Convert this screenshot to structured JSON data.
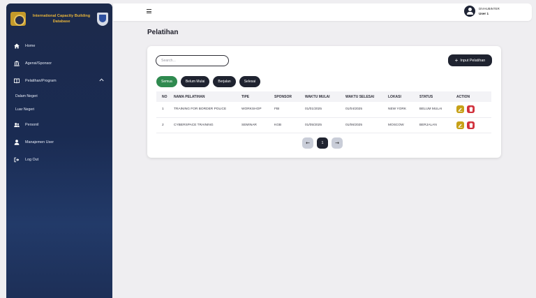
{
  "brand": {
    "title": "International Capacity Building Database"
  },
  "sidebar": {
    "items": [
      {
        "label": "Home",
        "icon": "home-icon"
      },
      {
        "label": "Agensi/Sponsor",
        "icon": "bank-icon"
      },
      {
        "label": "Pelatihan/Program",
        "icon": "book-icon",
        "expanded": true
      },
      {
        "label": "Dalam Negeri"
      },
      {
        "label": "Luar Negeri"
      },
      {
        "label": "Personil",
        "icon": "users-icon"
      },
      {
        "label": "Manajemen User",
        "icon": "user-icon"
      },
      {
        "label": "Log Out",
        "icon": "logout-icon"
      }
    ]
  },
  "topbar": {
    "user_name": "DIVHUBINTER",
    "user_role": "User 1"
  },
  "page": {
    "title": "Pelatihan"
  },
  "toolbar": {
    "search_placeholder": "Search...",
    "add_label": "Input Pelatihan"
  },
  "filters": [
    "Semua",
    "Belum Mulai",
    "Berjalan",
    "Selesai"
  ],
  "table": {
    "headers": [
      "NO",
      "NAMA PELATIHAN",
      "TIPE",
      "SPONSOR",
      "WAKTU MULAI",
      "WAKTU SELESAI",
      "LOKASI",
      "STATUS",
      "ACTION"
    ],
    "rows": [
      [
        "1",
        "TRAINING FOR BORDER POLICE",
        "WORKSHOP",
        "FBI",
        "01/01/2025",
        "01/04/2025",
        "NEW YORK",
        "BELUM MULAI"
      ],
      [
        "2",
        "CYBERSPACE TRAINING",
        "SEMINAR",
        "KGB",
        "01/05/2025",
        "01/06/2025",
        "MOSCOW",
        "BERJALAN"
      ]
    ]
  },
  "pagination": {
    "current": "1"
  },
  "colors": {
    "sidebar": "#1c2a4b",
    "accent_green": "#2f8a4f",
    "dark_button": "#1f2330",
    "edit": "#c7a117",
    "delete": "#d1313c"
  }
}
